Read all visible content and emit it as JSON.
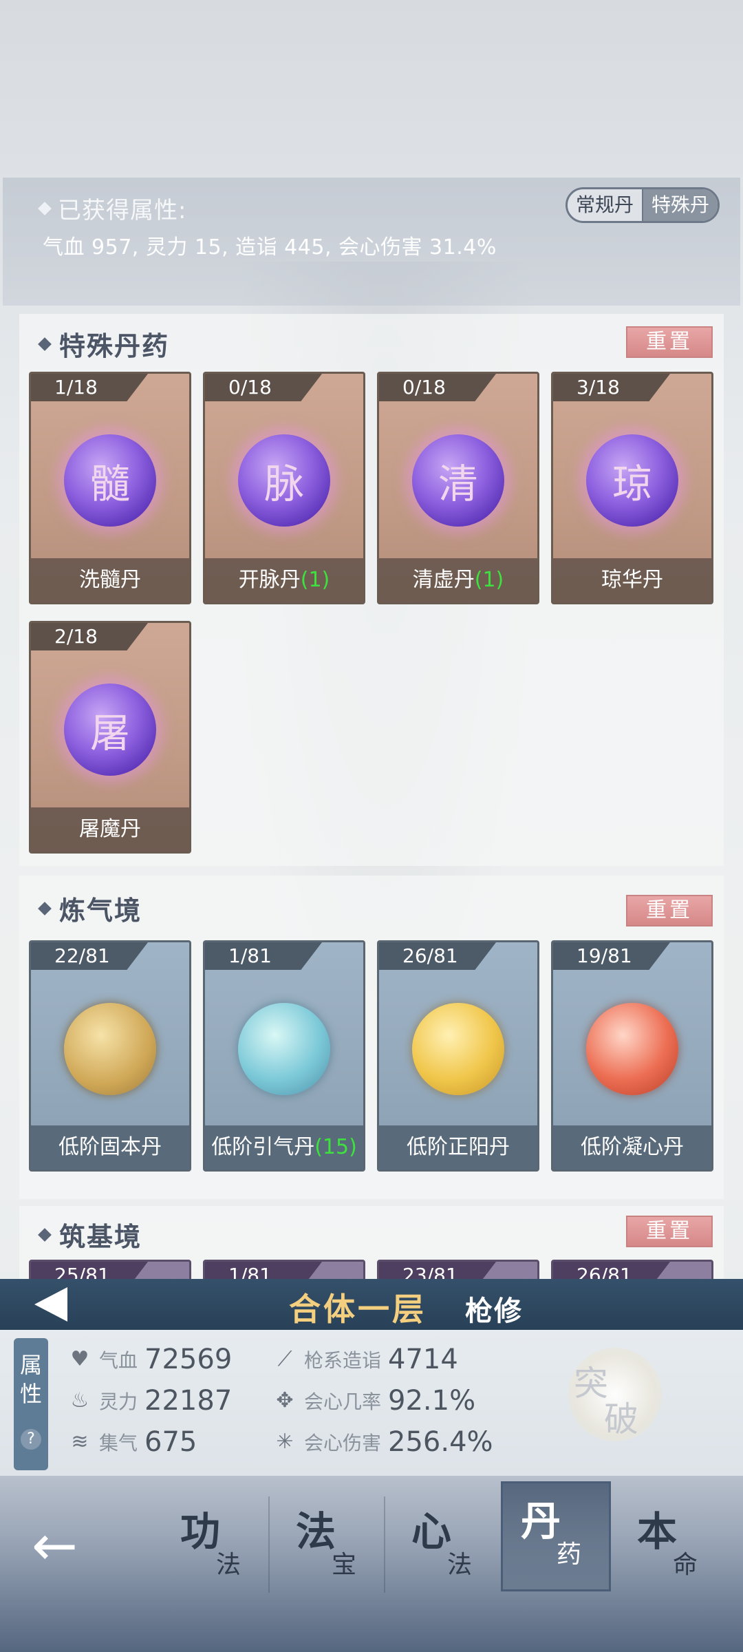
{
  "header": {
    "obtained_label": "已获得属性:",
    "obtained_attrs": "气血 957, 灵力 15, 造诣 445, 会心伤害 31.4%",
    "toggle": [
      "常规丹",
      "特殊丹"
    ],
    "toggle_active": "特殊丹"
  },
  "special_section": {
    "title": "特殊丹药",
    "reset_label": "重置",
    "cards": [
      {
        "count": "1/18",
        "glyph": "髓",
        "name": "洗髓丹",
        "bonus": ""
      },
      {
        "count": "0/18",
        "glyph": "脉",
        "name": "开脉丹",
        "bonus": "(1)"
      },
      {
        "count": "0/18",
        "glyph": "清",
        "name": "清虚丹",
        "bonus": "(1)"
      },
      {
        "count": "3/18",
        "glyph": "琼",
        "name": "琼华丹",
        "bonus": ""
      },
      {
        "count": "2/18",
        "glyph": "屠",
        "name": "屠魔丹",
        "bonus": ""
      }
    ]
  },
  "qi_section": {
    "title": "炼气境",
    "reset_label": "重置",
    "cards": [
      {
        "count": "22/81",
        "name": "低阶固本丹",
        "bonus": "",
        "orb": "gold"
      },
      {
        "count": "1/81",
        "name": "低阶引气丹",
        "bonus": "(15)",
        "orb": "cyan"
      },
      {
        "count": "26/81",
        "name": "低阶正阳丹",
        "bonus": "",
        "orb": "yellow"
      },
      {
        "count": "19/81",
        "name": "低阶凝心丹",
        "bonus": "",
        "orb": "red"
      }
    ]
  },
  "foundation_section": {
    "title": "筑基境",
    "reset_label": "重置",
    "counts": [
      "25/81",
      "1/81",
      "23/81",
      "26/81"
    ]
  },
  "realm": {
    "title": "合体一层",
    "subtitle": "枪修"
  },
  "stats": {
    "tab_label_1": "属",
    "tab_label_2": "性",
    "help": "?",
    "hp_label": "气血",
    "hp_value": "72569",
    "mana_label": "灵力",
    "mana_value": "22187",
    "qi_label": "集气",
    "qi_value": "675",
    "spear_label": "枪系造诣",
    "spear_value": "4714",
    "crit_rate_label": "会心几率",
    "crit_rate_value": "92.1%",
    "crit_dmg_label": "会心伤害",
    "crit_dmg_value": "256.4%",
    "breakthrough_1": "突",
    "breakthrough_2": "破"
  },
  "nav": {
    "back": "←",
    "items": [
      {
        "big": "功",
        "small": "法"
      },
      {
        "big": "法",
        "small": "宝"
      },
      {
        "big": "心",
        "small": "法"
      },
      {
        "big": "丹",
        "small": "药"
      },
      {
        "big": "本",
        "small": "命"
      }
    ],
    "active_index": 3
  }
}
